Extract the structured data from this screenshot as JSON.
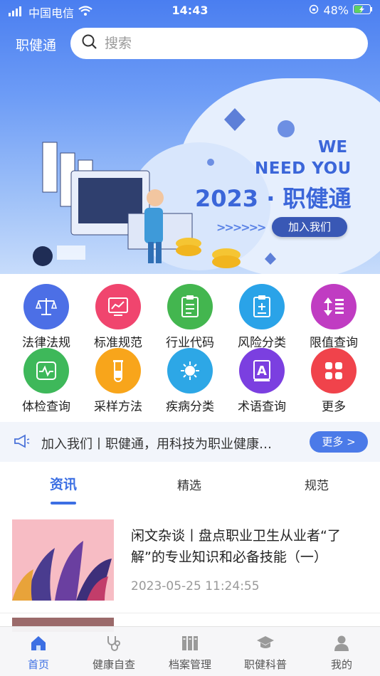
{
  "status_bar": {
    "carrier": "中国电信",
    "time": "14:43",
    "battery": "48%"
  },
  "header": {
    "app_name": "职健通",
    "search_placeholder": "搜索"
  },
  "banner": {
    "line1": "WE",
    "line2": "NEED YOU",
    "title": "2023 · 职健通",
    "arrows": ">>>>>>",
    "button": "加入我们"
  },
  "grid": [
    {
      "label": "法律法规",
      "icon": "scales-icon",
      "color": "#4c6fe6"
    },
    {
      "label": "标准规范",
      "icon": "chart-board-icon",
      "color": "#f0456e"
    },
    {
      "label": "行业代码",
      "icon": "clipboard-list-icon",
      "color": "#43b64f"
    },
    {
      "label": "风险分类",
      "icon": "clipboard-plus-icon",
      "color": "#2aa3e8"
    },
    {
      "label": "限值查询",
      "icon": "sort-list-icon",
      "color": "#c03cc2"
    },
    {
      "label": "体检查询",
      "icon": "heartbeat-icon",
      "color": "#3eb85a"
    },
    {
      "label": "采样方法",
      "icon": "test-tube-icon",
      "color": "#f8a51b"
    },
    {
      "label": "疾病分类",
      "icon": "virus-icon",
      "color": "#2da7e6"
    },
    {
      "label": "术语查询",
      "icon": "dictionary-icon",
      "color": "#7b3fe0"
    },
    {
      "label": "更多",
      "icon": "apps-icon",
      "color": "#f0434b"
    }
  ],
  "notice": {
    "text": "加入我们丨职健通，用科技为职业健康…",
    "more": "更多 >"
  },
  "tabs": [
    {
      "label": "资讯"
    },
    {
      "label": "精选"
    },
    {
      "label": "规范"
    }
  ],
  "articles": [
    {
      "title": "闲文杂谈丨盘点职业卫生从业者“了解”的专业知识和必备技能（一）",
      "time": "2023-05-25 11:24:55"
    }
  ],
  "tabbar": [
    {
      "label": "首页",
      "icon": "home-icon"
    },
    {
      "label": "健康自查",
      "icon": "stethoscope-icon"
    },
    {
      "label": "档案管理",
      "icon": "archive-icon"
    },
    {
      "label": "职健科普",
      "icon": "graduation-cap-icon"
    },
    {
      "label": "我的",
      "icon": "user-icon"
    }
  ],
  "colors": {
    "primary": "#3c6fe3",
    "banner_text": "#3b66d9"
  }
}
